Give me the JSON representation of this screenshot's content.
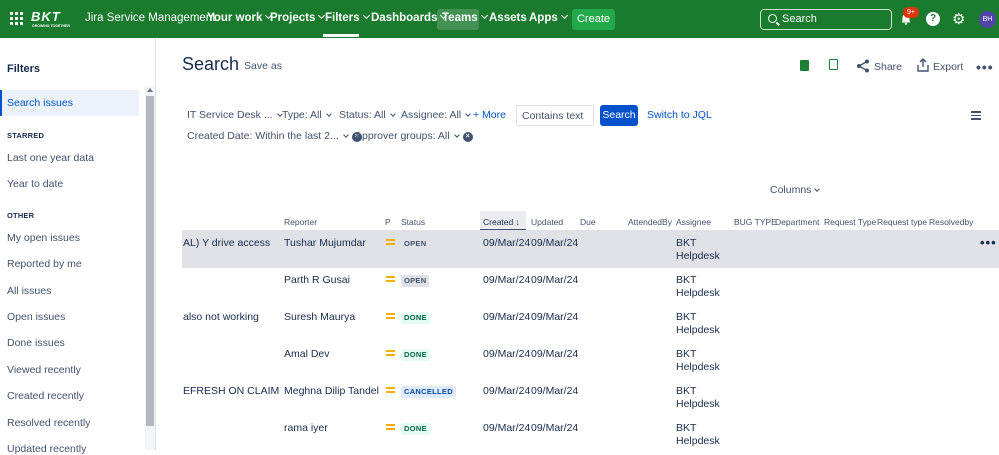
{
  "topbar": {
    "logo_text": "BKT",
    "logo_sub": "GROWING TOGETHER",
    "app_name": "Jira Service Management",
    "nav": [
      {
        "label": "Your work"
      },
      {
        "label": "Projects"
      },
      {
        "label": "Filters"
      },
      {
        "label": "Dashboards"
      },
      {
        "label": "Teams"
      },
      {
        "label": "Assets"
      },
      {
        "label": "Apps"
      }
    ],
    "create_label": "Create",
    "search_placeholder": "Search",
    "notifications_badge": "9+",
    "help_glyph": "?",
    "avatar_initials": "BH",
    "accent_color": "#1a7a2e"
  },
  "sidebar": {
    "title": "Filters",
    "selected": "Search issues",
    "starred_heading": "STARRED",
    "starred": [
      "Last one year data",
      "Year to date"
    ],
    "other_heading": "OTHER",
    "other": [
      "My open issues",
      "Reported by me",
      "All issues",
      "Open issues",
      "Done issues",
      "Viewed recently",
      "Created recently",
      "Resolved recently",
      "Updated recently"
    ]
  },
  "main": {
    "page_title": "Search",
    "save_as": "Save as",
    "share": "Share",
    "export": "Export",
    "filters": {
      "project": "IT Service Desk ...",
      "type": "Type: All",
      "status": "Status: All",
      "assignee": "Assignee: All",
      "more": "+ More",
      "text_placeholder": "Contains text",
      "search_button": "Search",
      "switch_jql": "Switch to JQL",
      "created_date": "Created Date: Within the last 2...",
      "approver_groups": "Approver groups: All"
    },
    "columns_button": "Columns",
    "table": {
      "headers": {
        "reporter": "Reporter",
        "p": "P",
        "status": "Status",
        "created": "Created",
        "updated": "Updated",
        "due": "Due",
        "attendedby": "AttendedBy",
        "assignee": "Assignee",
        "bug_type": "BUG TYPE",
        "department": "Department",
        "request_type": "Request Type",
        "request_type2": "Request type",
        "resolvedby": "Resolvedby"
      },
      "rows": [
        {
          "summary": "AL) Y drive access",
          "reporter": "Tushar Mujumdar",
          "status": "OPEN",
          "created": "09/Mar/24",
          "updated": "09/Mar/24",
          "assignee1": "BKT",
          "assignee2": "Helpdesk"
        },
        {
          "summary": "",
          "reporter": "Parth R Gusai",
          "status": "OPEN",
          "created": "09/Mar/24",
          "updated": "09/Mar/24",
          "assignee1": "BKT",
          "assignee2": "Helpdesk"
        },
        {
          "summary": "also not working",
          "reporter": "Suresh Maurya",
          "status": "DONE",
          "created": "09/Mar/24",
          "updated": "09/Mar/24",
          "assignee1": "BKT",
          "assignee2": "Helpdesk"
        },
        {
          "summary": "",
          "reporter": "Amal Dev",
          "status": "DONE",
          "created": "09/Mar/24",
          "updated": "09/Mar/24",
          "assignee1": "BKT",
          "assignee2": "Helpdesk"
        },
        {
          "summary": "EFRESH ON CLAIM",
          "reporter": "Meghna Dilip Tandel",
          "status": "CANCELLED",
          "created": "09/Mar/24",
          "updated": "09/Mar/24",
          "assignee1": "BKT",
          "assignee2": "Helpdesk"
        },
        {
          "summary": "",
          "reporter": "rama iyer",
          "status": "DONE",
          "created": "09/Mar/24",
          "updated": "09/Mar/24",
          "assignee1": "BKT",
          "assignee2": "Helpdesk"
        }
      ]
    }
  }
}
